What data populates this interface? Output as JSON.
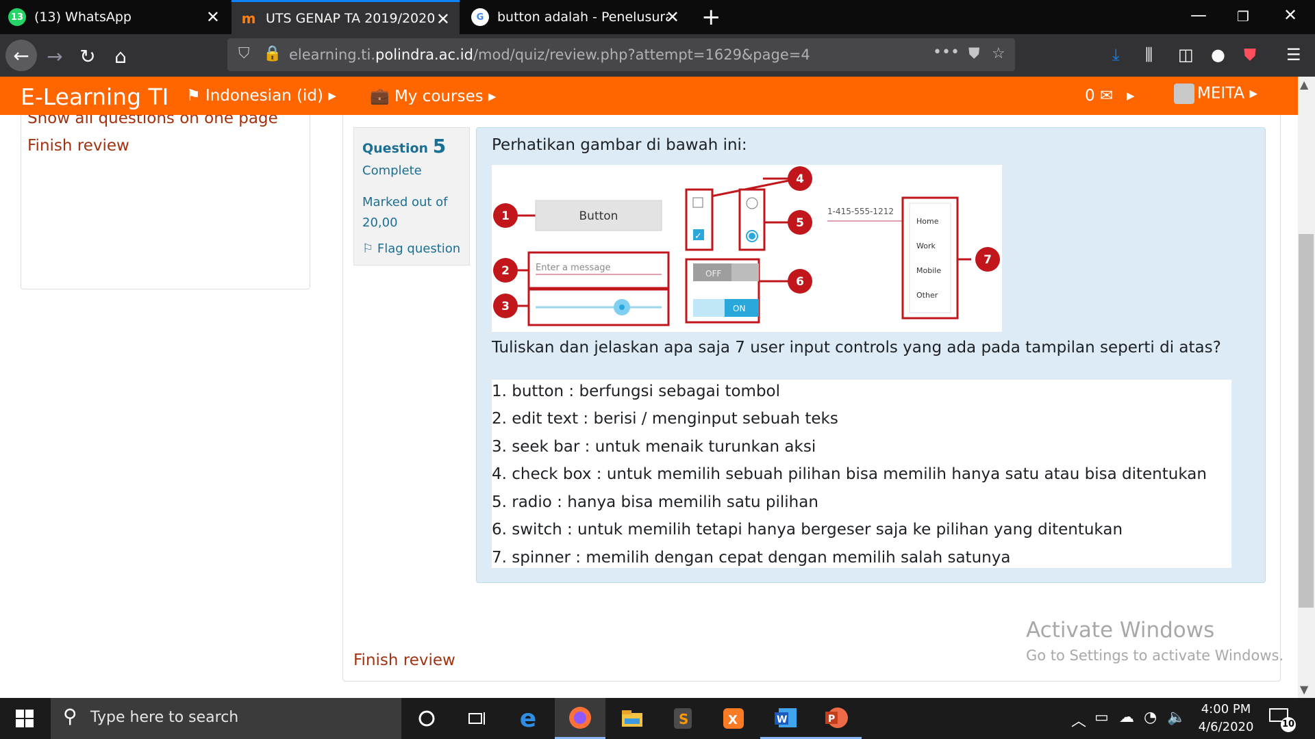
{
  "browser": {
    "tabs": [
      {
        "label": "(13) WhatsApp",
        "badge": "13",
        "favicon": "whatsapp-icon",
        "color": "#25d366"
      },
      {
        "label": "UTS GENAP TA 2019/2020",
        "favicon": "moodle-icon",
        "color": "#f98012"
      },
      {
        "label": "button adalah - Penelusuran Go",
        "favicon": "google-icon",
        "color": "#4285f4"
      }
    ],
    "url_prefix": "elearning.ti.",
    "url_domain": "polindra.ac.id",
    "url_path": "/mod/quiz/review.php?attempt=1629&page=4"
  },
  "header": {
    "brand": "E-Learning TI",
    "language": "Indonesian (id)",
    "courses": "My courses",
    "messages_count": "0",
    "user": "MEITA",
    "accent": "#ff6600"
  },
  "sidebar": {
    "show_all": "Show all questions on one page",
    "finish": "Finish review"
  },
  "question": {
    "label": "Question",
    "number": "5",
    "state": "Complete",
    "marked_line1": "Marked out of",
    "marked_line2": "20,00",
    "flag": "Flag question",
    "prompt": "Perhatikan gambar di bawah ini:",
    "text": "Tuliskan dan jelaskan apa saja 7 user input controls yang ada pada tampilan seperti di atas?",
    "answer_lines": [
      "1. button  : berfungsi sebagai tombol",
      "2. edit text : berisi / menginput sebuah teks",
      "3. seek bar : untuk menaik turunkan aksi",
      "4. check box : untuk memilih sebuah pilihan bisa memilih hanya satu atau bisa ditentukan",
      "5. radio : hanya bisa memilih satu pilihan",
      "6. switch : untuk memilih tetapi hanya bergeser saja ke pilihan yang ditentukan",
      "7. spinner : memilih dengan cepat dengan memilih salah satunya"
    ]
  },
  "figure": {
    "button_label": "Button",
    "edit_placeholder": "Enter a message",
    "switch_off": "OFF",
    "switch_on": "ON",
    "phone": "1-415-555-1212",
    "spinner_items": [
      "Home",
      "Work",
      "Mobile",
      "Other"
    ],
    "callouts": [
      "1",
      "2",
      "3",
      "4",
      "5",
      "6",
      "7"
    ]
  },
  "footer": {
    "finish": "Finish review"
  },
  "watermark": {
    "title": "Activate Windows",
    "subtitle": "Go to Settings to activate Windows."
  },
  "taskbar": {
    "search_placeholder": "Type here to search",
    "time": "4:00 PM",
    "date": "4/6/2020",
    "notifications": "10",
    "apps": [
      "cortana-icon",
      "task-view-icon",
      "edge-icon",
      "firefox-icon",
      "file-explorer-icon",
      "sublime-text-icon",
      "xampp-icon",
      "word-icon",
      "powerpoint-icon"
    ]
  }
}
